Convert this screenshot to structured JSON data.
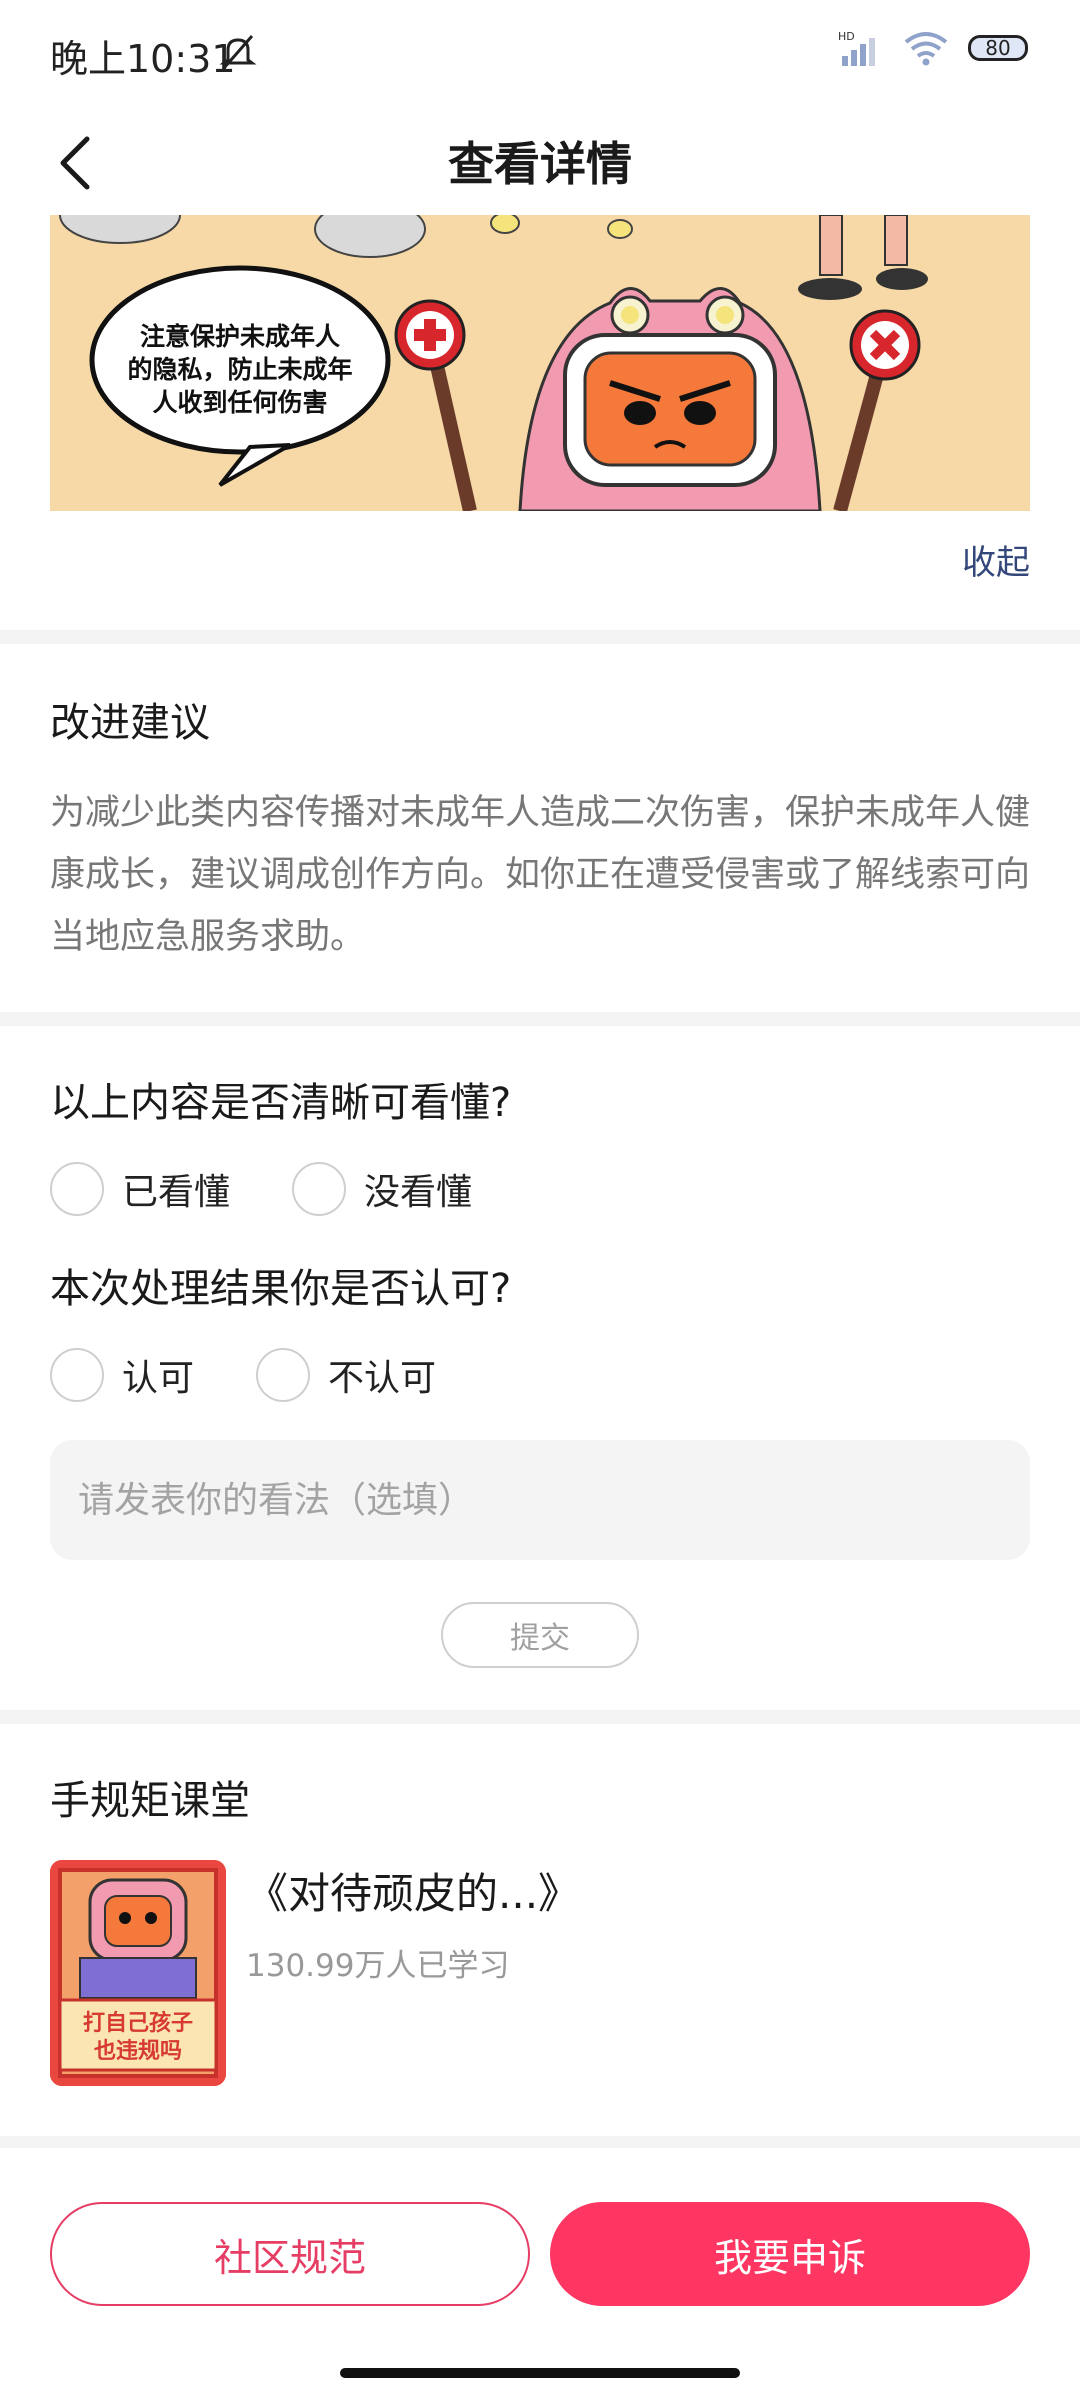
{
  "status_bar": {
    "time": "晚上10:31",
    "battery": "80",
    "network": "HD"
  },
  "header": {
    "title": "查看详情"
  },
  "banner": {
    "speech": [
      "注意保护未成年人",
      "的隐私，防止未成年",
      "人收到任何伤害"
    ]
  },
  "collapse_label": "收起",
  "improvement": {
    "title": "改进建议",
    "text": "为减少此类内容传播对未成年人造成二次伤害，保护未成年人健康成长，建议调成创作方向。如你正在遭受侵害或了解线索可向当地应急服务求助。"
  },
  "feedback": {
    "q1": "以上内容是否清晰可看懂?",
    "q1_opt1": "已看懂",
    "q1_opt2": "没看懂",
    "q2": "本次处理结果你是否认可?",
    "q2_opt1": "认可",
    "q2_opt2": "不认可",
    "placeholder": "请发表你的看法（选填）",
    "submit": "提交"
  },
  "course": {
    "section_title": "手规矩课堂",
    "title": "《对待顽皮的...》",
    "learners": "130.99万人已学习",
    "thumb_text": [
      "打自己孩子",
      "也违规吗"
    ]
  },
  "bottom": {
    "guidelines": "社区规范",
    "appeal": "我要申诉"
  },
  "colors": {
    "accent": "#fe3661",
    "link": "#33477a",
    "banner_bg": "#f6d9a7"
  }
}
